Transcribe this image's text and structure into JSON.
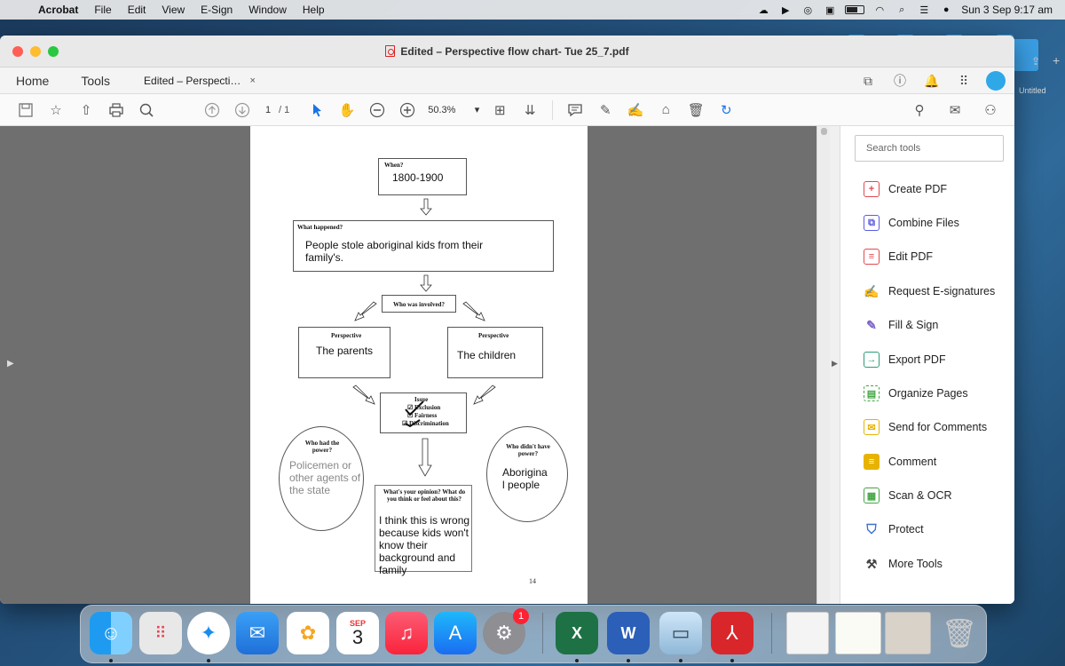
{
  "menubar": {
    "app": "Acrobat",
    "items": [
      "File",
      "Edit",
      "View",
      "E-Sign",
      "Window",
      "Help"
    ],
    "clock": "Sun 3 Sep  9:17 am"
  },
  "window": {
    "title": "Edited – Perspective flow chart- Tue 25_7.pdf"
  },
  "tabs": {
    "home": "Home",
    "tools": "Tools",
    "document": "Edited – Perspecti…",
    "close": "×"
  },
  "toolbar": {
    "page_current": "1",
    "page_total": "/ 1",
    "zoom": "50.3%",
    "zoom_caret": "▾"
  },
  "document": {
    "when_label": "When?",
    "when_value": "1800-1900",
    "what_label": "What happened?",
    "what_value": "People stole aboriginal kids from their family's.",
    "involved_label": "Who was involved?",
    "persp_left_label": "Perspective",
    "persp_left_value": "The parents",
    "persp_right_label": "Perspective",
    "persp_right_value": "The children",
    "issue_label": "Issue",
    "issue_opt1": "Exclusion",
    "issue_opt2": "Fairness",
    "issue_opt3": "Discrimination",
    "power_label": "Who had the power?",
    "power_value": "Policemen or other agents of the state",
    "nopower_label": "Who didn't have power?",
    "nopower_value": "Aborigina l people",
    "opinion_label": "What's your opinion? What do you think or feel about this?",
    "opinion_value": "I think this is wrong because kids won't know their background and family",
    "page_number": "14"
  },
  "tools_panel": {
    "search_placeholder": "Search tools",
    "items": [
      {
        "label": "Create PDF",
        "color": "#e34850"
      },
      {
        "label": "Combine Files",
        "color": "#5c5ce0"
      },
      {
        "label": "Edit PDF",
        "color": "#e34850"
      },
      {
        "label": "Request E-signatures",
        "color": "#b44dd6"
      },
      {
        "label": "Fill & Sign",
        "color": "#7d63c9"
      },
      {
        "label": "Export PDF",
        "color": "#2d9d78"
      },
      {
        "label": "Organize Pages",
        "color": "#44a544"
      },
      {
        "label": "Send for Comments",
        "color": "#e8b300"
      },
      {
        "label": "Comment",
        "color": "#e8b300"
      },
      {
        "label": "Scan & OCR",
        "color": "#44a544"
      },
      {
        "label": "Protect",
        "color": "#3b6fd4"
      },
      {
        "label": "More Tools",
        "color": "#444444"
      }
    ]
  },
  "desktop": {
    "untitled": "Untitled"
  },
  "dock": {
    "calendar_month": "SEP",
    "calendar_day": "3",
    "settings_badge": "1"
  }
}
